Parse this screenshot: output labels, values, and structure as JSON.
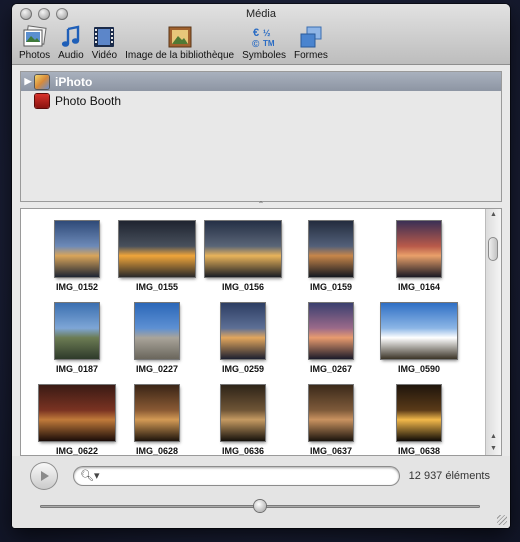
{
  "window": {
    "title": "Média"
  },
  "toolbar": [
    {
      "label": "Photos",
      "icon": "photos-icon",
      "active": true
    },
    {
      "label": "Audio",
      "icon": "music-note-icon",
      "active": false
    },
    {
      "label": "Vidéo",
      "icon": "film-strip-icon",
      "active": false
    },
    {
      "label": "Image de la bibliothèque",
      "icon": "library-image-icon",
      "active": false
    },
    {
      "label": "Symboles",
      "icon": "symbols-icon",
      "active": false
    },
    {
      "label": "Formes",
      "icon": "shapes-icon",
      "active": false
    }
  ],
  "sources": [
    {
      "label": "iPhoto",
      "icon": "iphoto-icon",
      "selected": true,
      "expandable": true
    },
    {
      "label": "Photo Booth",
      "icon": "photo-booth-icon",
      "selected": false,
      "expandable": false
    }
  ],
  "photos": [
    {
      "name": "IMG_0152",
      "orientation": "portrait",
      "palette": [
        "#2f4a78",
        "#6d8ab8",
        "#d9a55a",
        "#1e2533"
      ]
    },
    {
      "name": "IMG_0155",
      "orientation": "landscape",
      "palette": [
        "#1f2430",
        "#48505c",
        "#f0a53a",
        "#2a2a2a"
      ]
    },
    {
      "name": "IMG_0156",
      "orientation": "landscape",
      "palette": [
        "#253046",
        "#5a6577",
        "#e8b35a",
        "#1a1d24"
      ]
    },
    {
      "name": "IMG_0159",
      "orientation": "portrait",
      "palette": [
        "#232c3e",
        "#536079",
        "#c7864a",
        "#141820"
      ]
    },
    {
      "name": "IMG_0164",
      "orientation": "portrait",
      "palette": [
        "#3a2f55",
        "#b85a4a",
        "#e9a06a",
        "#1b1a24"
      ]
    },
    {
      "name": "IMG_0187",
      "orientation": "portrait",
      "palette": [
        "#3b6fb0",
        "#7ea6d6",
        "#6c7c54",
        "#2e3a2a"
      ]
    },
    {
      "name": "IMG_0227",
      "orientation": "portrait",
      "palette": [
        "#2b67b8",
        "#5e90d3",
        "#a9a49a",
        "#6a665c"
      ]
    },
    {
      "name": "IMG_0259",
      "orientation": "portrait",
      "palette": [
        "#2d3e63",
        "#5d6f95",
        "#e2a65d",
        "#1d2030"
      ]
    },
    {
      "name": "IMG_0267",
      "orientation": "portrait",
      "palette": [
        "#3a3f6e",
        "#9b6a8a",
        "#e89b6e",
        "#1c1b2a"
      ]
    },
    {
      "name": "IMG_0590",
      "orientation": "landscape",
      "palette": [
        "#2f6fc4",
        "#8cb6e6",
        "#ffffff",
        "#3c3528"
      ]
    },
    {
      "name": "IMG_0622",
      "orientation": "landscape",
      "palette": [
        "#3a1a14",
        "#7a3322",
        "#c07a3a",
        "#1a0c08"
      ]
    },
    {
      "name": "IMG_0628",
      "orientation": "portrait",
      "palette": [
        "#3a2516",
        "#8a5a34",
        "#d39a55",
        "#1d130b"
      ]
    },
    {
      "name": "IMG_0636",
      "orientation": "portrait",
      "palette": [
        "#2e2418",
        "#6f5536",
        "#c59a62",
        "#15110b"
      ]
    },
    {
      "name": "IMG_0637",
      "orientation": "portrait",
      "palette": [
        "#3b2a1a",
        "#7e5a3a",
        "#c99260",
        "#1a130c"
      ]
    },
    {
      "name": "IMG_0638",
      "orientation": "portrait",
      "palette": [
        "#1f150c",
        "#5a3a18",
        "#f2b84a",
        "#0e0a06"
      ]
    }
  ],
  "search": {
    "value": "",
    "placeholder": ""
  },
  "status": {
    "count": "12 937 éléments"
  },
  "thumbnail_size_slider": {
    "value": 0.5
  },
  "colors": {
    "selection": "#9ea6b4",
    "accent": "#3b7dd8"
  }
}
